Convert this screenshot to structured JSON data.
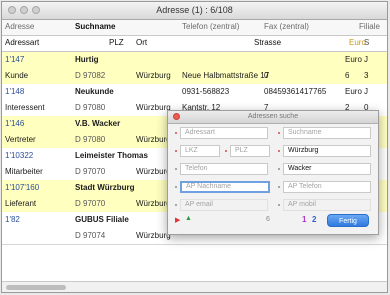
{
  "window": {
    "title": "Adresse (1) : 6/108"
  },
  "header1": {
    "c1": "Adresse",
    "c2": "Suchname",
    "c3": "Telefon (zentral)",
    "c4": "Fax (zentral)",
    "c5": "Filiale"
  },
  "header2": {
    "c1": "Adressart",
    "c2": "PLZ",
    "c3": "Ort",
    "c4": "Strasse",
    "c5": "Euro",
    "c6": "S"
  },
  "rows": [
    {
      "a": "1'147",
      "b": "Hurtig",
      "c": "",
      "d": "",
      "e": "",
      "f": "Euro",
      "g": "J"
    },
    {
      "a": "Kunde",
      "b": "D 97082",
      "c": "Würzburg",
      "d": "Neue Halbmattstraße 17",
      "e": "0",
      "f": "6",
      "g": "3"
    },
    {
      "a": "1'148",
      "b": "Neukunde",
      "c": "",
      "d": "0931-568823",
      "e": "08459361417765",
      "f": "Euro",
      "g": "J"
    },
    {
      "a": "Interessent",
      "b": "D 97080",
      "c": "Würzburg",
      "d": "Kantstr. 12",
      "e": "7",
      "f": "2",
      "g": "0"
    },
    {
      "a": "1'146",
      "b": "V.B. Wacker",
      "c": "",
      "d": "",
      "e": "",
      "f": "",
      "g": ""
    },
    {
      "a": "Vertreter",
      "b": "D 97080",
      "c": "Würzburg",
      "d": "",
      "e": "",
      "f": "",
      "g": ""
    },
    {
      "a": "1'10322",
      "b": "Leimeister Thomas",
      "c": "",
      "d": "",
      "e": "",
      "f": "",
      "g": ""
    },
    {
      "a": "Mitarbeiter",
      "b": "D 97070",
      "c": "Würzburg",
      "d": "",
      "e": "",
      "f": "",
      "g": ""
    },
    {
      "a": "1'107'160",
      "b": "Stadt Würzburg",
      "c": "",
      "d": "",
      "e": "",
      "f": "",
      "g": ""
    },
    {
      "a": "Lieferant",
      "b": "D 97070",
      "c": "Würzburg",
      "d": "",
      "e": "",
      "f": "",
      "g": ""
    },
    {
      "a": "1'82",
      "b": "GUBUS Filiale",
      "c": "",
      "d": "",
      "e": "",
      "f": "",
      "g": ""
    },
    {
      "a": "",
      "b": "D 97074",
      "c": "Würzburg",
      "d": "",
      "e": "",
      "f": "",
      "g": ""
    }
  ],
  "dialog": {
    "title": "Adressen suche",
    "adressart": "Adressart",
    "suchname": "Suchname",
    "lkz": "LKZ",
    "plz": "PLZ",
    "ort": "Würzburg",
    "telefon": "Telefon",
    "strasse": "Wacker",
    "ap_nachname": "AP Nachname",
    "ap_telefon": "AP Telefon",
    "ap_email": "AP email",
    "ap_mobil": "AP mobil",
    "count": "6",
    "nav1": "1",
    "nav2": "2",
    "fertig": "Fertig"
  }
}
